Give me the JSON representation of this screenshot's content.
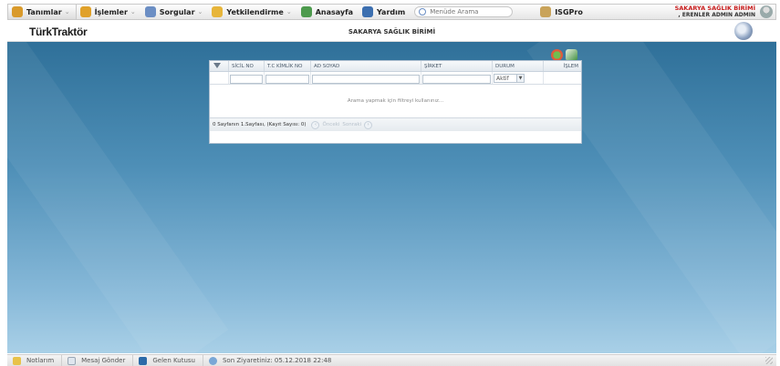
{
  "menu": {
    "items": [
      {
        "label": "Tanımlar",
        "icon": "definitions-icon",
        "color": "#d99a2b",
        "has_arrow": true
      },
      {
        "label": "İşlemler",
        "icon": "operations-icon",
        "color": "#e0a12a",
        "has_arrow": true
      },
      {
        "label": "Sorgular",
        "icon": "search-queries-icon",
        "color": "#6b8ec4",
        "has_arrow": true
      },
      {
        "label": "Yetkilendirme",
        "icon": "authorization-icon",
        "color": "#e7b53a",
        "has_arrow": true
      },
      {
        "label": "Anasayfa",
        "icon": "home-icon",
        "color": "#4d9a4d",
        "has_arrow": false
      },
      {
        "label": "Yardım",
        "icon": "help-icon",
        "color": "#3c6fb0",
        "has_arrow": false
      }
    ],
    "search_placeholder": "Menüde Arama",
    "isgpro_label": "ISGPro",
    "user_unit": "SAKARYA SAĞLIK BİRİMİ",
    "user_name": ", ERENLER ADMIN ADMIN"
  },
  "header": {
    "brand": "TürkTraktör",
    "unit_title": "SAKARYA SAĞLIK BİRİMİ"
  },
  "grid": {
    "columns": [
      "SİCİL NO",
      "T.C KİMLİK NO",
      "AD SOYAD",
      "ŞİRKET",
      "DURUM",
      "İŞLEM"
    ],
    "status_filter_value": "Aktif",
    "empty_message": "Arama yapmak için filtreyi kullanınız...",
    "footer_text": "0 Sayfanın 1.Sayfası, (Kayıt Sayısı: 0)",
    "prev_label": "Önceki",
    "next_label": "Sonraki"
  },
  "statusbar": {
    "notes": "Notlarım",
    "send_message": "Mesaj Gönder",
    "inbox": "Gelen Kutusu",
    "last_visit": "Son Ziyaretiniz: 05.12.2018 22:48"
  },
  "colors": {
    "workspace_top": "#2f7099",
    "workspace_bottom": "#a9d0e7",
    "user_unit_red": "#c81d1d"
  }
}
